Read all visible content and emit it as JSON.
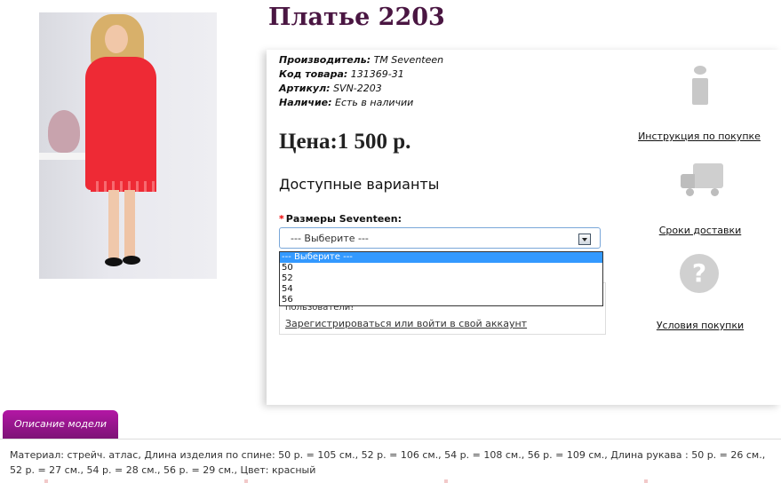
{
  "product": {
    "title": "Платье 2203",
    "manufacturer_label": "Производитель:",
    "manufacturer": "TM Seventeen",
    "code_label": "Код товара:",
    "code": "131369-31",
    "article_label": "Артикул:",
    "article": "SVN-2203",
    "availability_label": "Наличие:",
    "availability": "Есть в наличии",
    "price": "Цена:1 500 р."
  },
  "variants": {
    "heading": "Доступные варианты",
    "required_mark": "*",
    "size_label": "Размеры Seventeen:",
    "selected": "--- Выберите ---",
    "options": [
      "--- Выберите ---",
      "50",
      "52",
      "54",
      "56"
    ]
  },
  "login": {
    "text": "пользователи!",
    "link": "Зарегистрироваться или войти в свой аккаунт"
  },
  "side": {
    "instructions": "Инструкция по покупке",
    "delivery": "Сроки доставки",
    "terms": "Условия покупки"
  },
  "description": {
    "tab": "Описание модели",
    "text": "Материал: стрейч. атлас, Длина изделия по спине: 50 р. = 105 см., 52 р. = 106 см., 54 р. = 108 см., 56 р. = 109 см., Длина рукава : 50 р. = 26 см., 52 р. = 27 см., 54 р. = 28 см., 56 р. = 29 см., Цвет: красный"
  }
}
